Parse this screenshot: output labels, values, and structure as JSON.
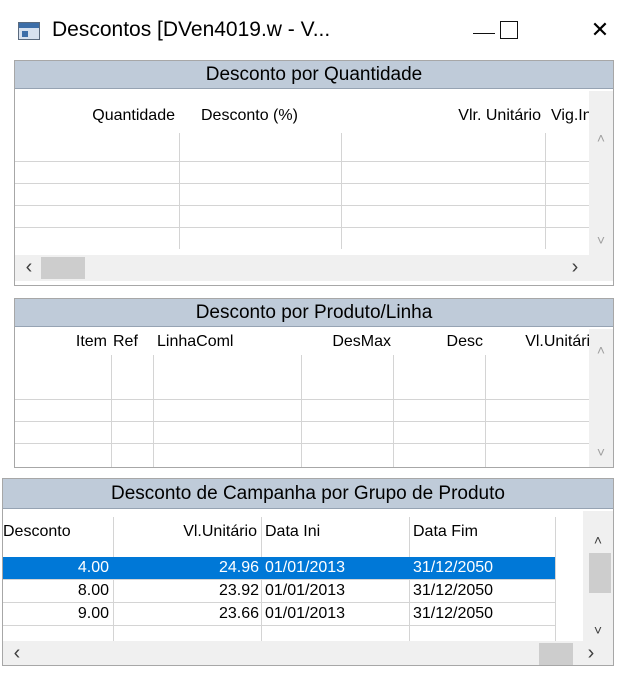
{
  "window": {
    "title": "Descontos [DVen4019.w - V...",
    "icon": "app-window-icon",
    "controls": {
      "minimize": "minimize-icon",
      "maximize": "maximize-icon",
      "close": "close-icon",
      "close_glyph": "✕"
    }
  },
  "scroll_glyphs": {
    "up": "˄",
    "down": "˅",
    "left": "‹",
    "right": "›"
  },
  "panels": {
    "quantidade": {
      "title": "Desconto por Quantidade",
      "columns": [
        "Quantidade",
        "Desconto (%)",
        "Vlr. Unitário",
        "Vig.In"
      ],
      "rows": []
    },
    "produto": {
      "title": "Desconto por Produto/Linha",
      "columns": [
        "Item",
        "Ref",
        "LinhaComl",
        "DesMax",
        "Desc",
        "Vl.Unitário"
      ],
      "rows": []
    },
    "campanha": {
      "title": "Desconto de Campanha por Grupo de Produto",
      "columns": [
        "Desconto",
        "Vl.Unitário",
        "Data Ini",
        "Data Fim"
      ],
      "rows": [
        {
          "desconto": "4.00",
          "vl_unitario": "24.96",
          "data_ini": "01/01/2013",
          "data_fim": "31/12/2050",
          "selected": true
        },
        {
          "desconto": "8.00",
          "vl_unitario": "23.92",
          "data_ini": "01/01/2013",
          "data_fim": "31/12/2050",
          "selected": false
        },
        {
          "desconto": "9.00",
          "vl_unitario": "23.66",
          "data_ini": "01/01/2013",
          "data_fim": "31/12/2050",
          "selected": false
        }
      ]
    }
  },
  "colors": {
    "panel_header": "#bfcbd9",
    "selection": "#0078d7"
  }
}
